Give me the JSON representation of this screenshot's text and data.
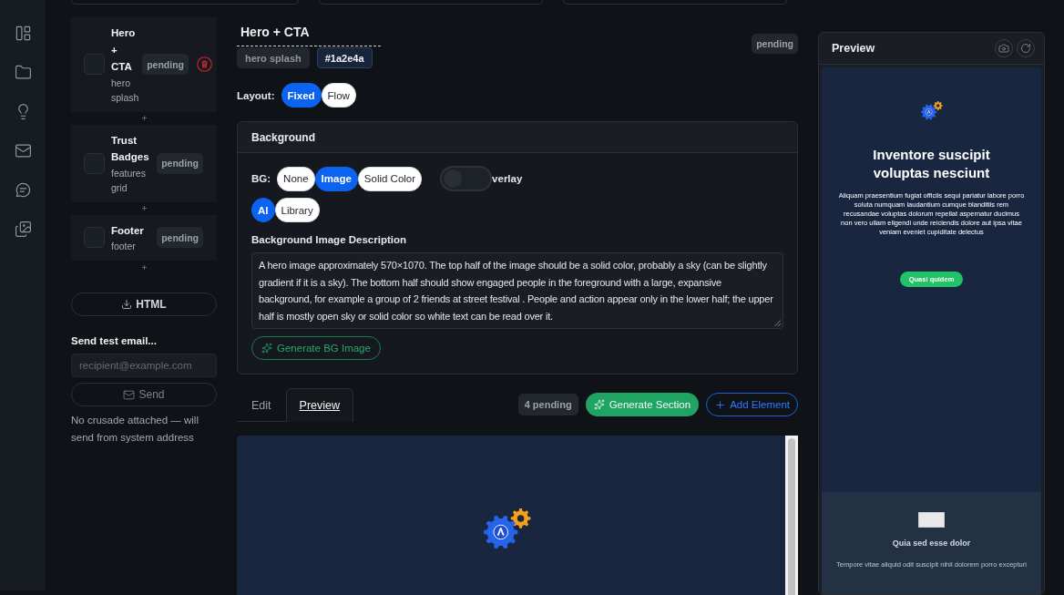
{
  "sections": [
    {
      "title": "Hero + CTA",
      "subtitle": "hero splash",
      "status": "pending",
      "checked": false,
      "deletable": true
    },
    {
      "title": "Trust Badges",
      "subtitle": "features grid",
      "status": "pending",
      "checked": false,
      "deletable": false
    },
    {
      "title": "Footer",
      "subtitle": "footer",
      "status": "pending",
      "checked": false,
      "deletable": false
    }
  ],
  "export_button": "HTML",
  "test_email": {
    "label": "Send test email...",
    "placeholder": "recipient@example.com",
    "send_button": {
      "label": "Send",
      "disabled": true
    },
    "note": "No crusade attached — will send from system address"
  },
  "editor": {
    "title": "Hero + CTA",
    "tags": [
      {
        "kind": "type",
        "label": "hero splash"
      },
      {
        "kind": "color",
        "label": "#1a2e4a"
      }
    ],
    "status": "pending",
    "layout": {
      "label": "Layout:",
      "options": [
        {
          "label": "Fixed",
          "selected": true
        },
        {
          "label": "Flow",
          "selected": false
        }
      ]
    },
    "background": {
      "title": "Background",
      "bg_label": "BG:",
      "bg_options": [
        {
          "label": "None",
          "selected": false
        },
        {
          "label": "Image",
          "selected": true
        },
        {
          "label": "Solid Color",
          "selected": false
        }
      ],
      "overlay": {
        "on": false,
        "label": "verlay"
      },
      "source_options": [
        {
          "label": "AI",
          "selected": true
        },
        {
          "label": "Library",
          "selected": false
        }
      ],
      "description_label": "Background Image Description",
      "description": "A hero image approximately 570×1070. The top half of the image should be a solid color, probably a sky (can be slightly gradient if it is a sky). The bottom half should show engaged people in the foreground with a large, expansive background, for example a group of 2 friends at street festival . People and action appear only in the lower half; the upper half is mostly open sky or solid color so white text can be read over it.",
      "generate_button": "Generate BG Image"
    },
    "tabs": [
      {
        "label": "Edit",
        "selected": false
      },
      {
        "label": "Preview",
        "selected": true
      }
    ],
    "pending_count": "4 pending",
    "generate_section_button": "Generate Section",
    "add_element_button": "Add Element"
  },
  "preview": {
    "title": "Preview",
    "hero": {
      "heading": "Inventore suscipit voluptas nesciunt",
      "body": "Aliquam praesentium fugiat officiis sequi pariatur labore porro soluta numquam laudantium cumque blanditiis rem recusandae voluptas dolorum repellat aspernatur ducimus non vero ullam eligendi unde reiciendis dolore aut ipsa vitae veniam eveniet cupiditate delectus",
      "button": "Quasi quidem"
    },
    "next_section": {
      "heading": "Quia sed esse dolor",
      "body": "Tempore vitae aliquid odit suscipit nihil dolorem porro excepturi"
    }
  }
}
